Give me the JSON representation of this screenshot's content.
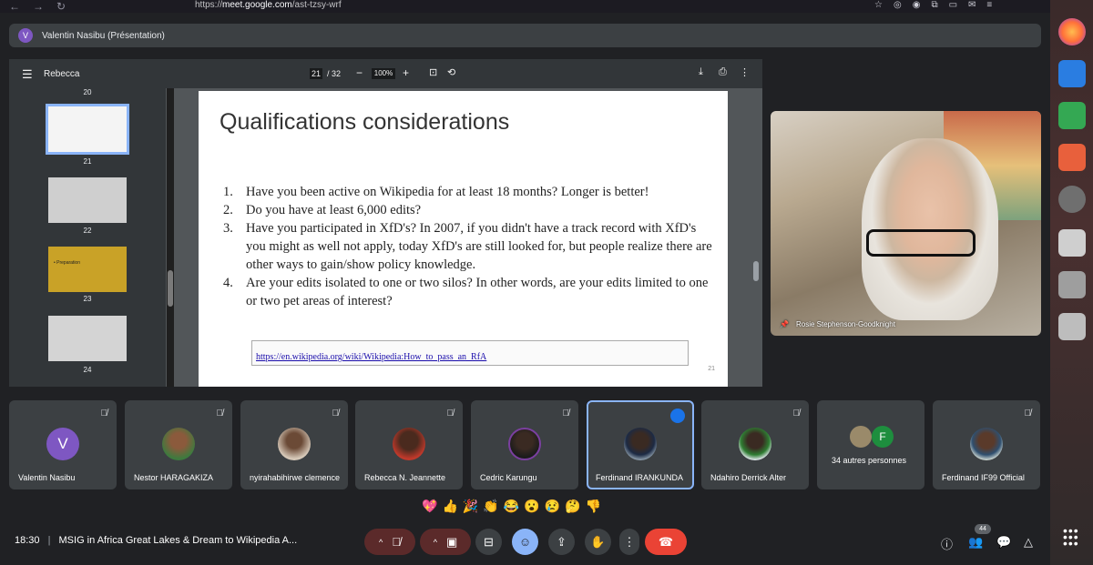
{
  "browser": {
    "url_prefix": "https://",
    "url_domain": "meet.google.com",
    "url_path": "/ast-tzsy-wrf"
  },
  "presenter": {
    "avatar_letter": "V",
    "label": "Valentin Nasibu (Présentation)"
  },
  "pdf": {
    "title": "Rebecca",
    "page_current": "21",
    "page_total": "/ 32",
    "zoom": "100%",
    "thumbnails": [
      {
        "num": "20"
      },
      {
        "num": "21"
      },
      {
        "num": "22"
      },
      {
        "num": "23"
      },
      {
        "num": "24"
      }
    ],
    "thumb_23_text": "• Preparation"
  },
  "slide": {
    "title": "Qualifications considerations",
    "items": [
      {
        "num": "1.",
        "text": "Have you been active on Wikipedia for at least 18 months? Longer is better!"
      },
      {
        "num": "2.",
        "text": "Do you have at least 6,000 edits?"
      },
      {
        "num": "3.",
        "text": "Have you participated in XfD's? In 2007, if you didn't have a track record with XfD's you might as well not apply, today XfD's are still looked for, but people realize there are other ways to gain/show policy knowledge."
      },
      {
        "num": "4.",
        "text": "Are your edits isolated to one or two silos? In other words, are your edits limited to one or two pet areas of interest?"
      }
    ],
    "link": "https://en.wikipedia.org/wiki/Wikipedia:How_to_pass_an_RfA",
    "page_number": "21"
  },
  "self_video": {
    "name": "Rosie Stephenson-Goodknight"
  },
  "participants": [
    {
      "name": "Valentin Nasibu",
      "initial": "V",
      "color": "#7e57c2"
    },
    {
      "name": "Nestor HARAGAKIZA",
      "initial": "",
      "color": "#4a6a4a"
    },
    {
      "name": "nyirahabihirwe clemence",
      "initial": "",
      "color": "#8a7a6a"
    },
    {
      "name": "Rebecca N. Jeannette",
      "initial": "",
      "color": "#c0392b"
    },
    {
      "name": "Cedric Karungu",
      "initial": "",
      "color": "#5a3a6a"
    },
    {
      "name": "Ferdinand IRANKUNDA",
      "initial": "",
      "color": "#6a7a8a"
    },
    {
      "name": "Ndahiro Derrick Alter",
      "initial": "",
      "color": "#dfe7ea"
    },
    {
      "name": "34 autres personnes",
      "initial": "F",
      "color": "#1e8e3e"
    },
    {
      "name": "Ferdinand IF99 Official",
      "initial": "",
      "color": "#c9d3cf"
    }
  ],
  "reactions": [
    "💖",
    "👍",
    "🎉",
    "👏",
    "😂",
    "😮",
    "😢",
    "🤔",
    "👎"
  ],
  "meeting": {
    "time": "18:30",
    "separator": "|",
    "title": "MSIG in Africa Great Lakes & Dream to Wikipedia A..."
  },
  "participant_count": "44"
}
